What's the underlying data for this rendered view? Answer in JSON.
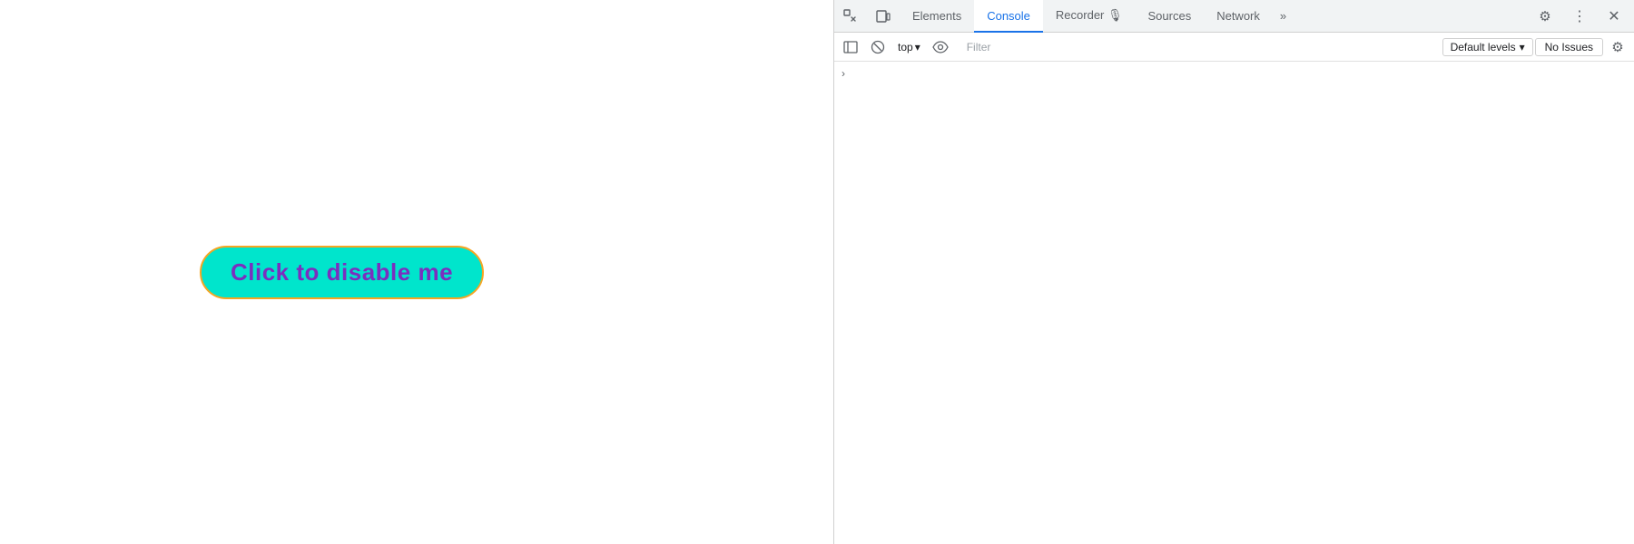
{
  "main_page": {
    "button_label": "Click to disable me"
  },
  "devtools": {
    "tabs": [
      {
        "id": "elements",
        "label": "Elements",
        "active": false
      },
      {
        "id": "console",
        "label": "Console",
        "active": true
      },
      {
        "id": "recorder",
        "label": "Recorder 🔴",
        "active": false
      },
      {
        "id": "sources",
        "label": "Sources",
        "active": false
      },
      {
        "id": "network",
        "label": "Network",
        "active": false
      }
    ],
    "toolbar": {
      "top_label": "top",
      "top_arrow": "▾",
      "filter_placeholder": "Filter",
      "default_levels_label": "Default levels",
      "default_levels_arrow": "▾",
      "no_issues_label": "No Issues",
      "more_tabs_icon": "»"
    },
    "console_content": {
      "chevron": "›"
    }
  }
}
